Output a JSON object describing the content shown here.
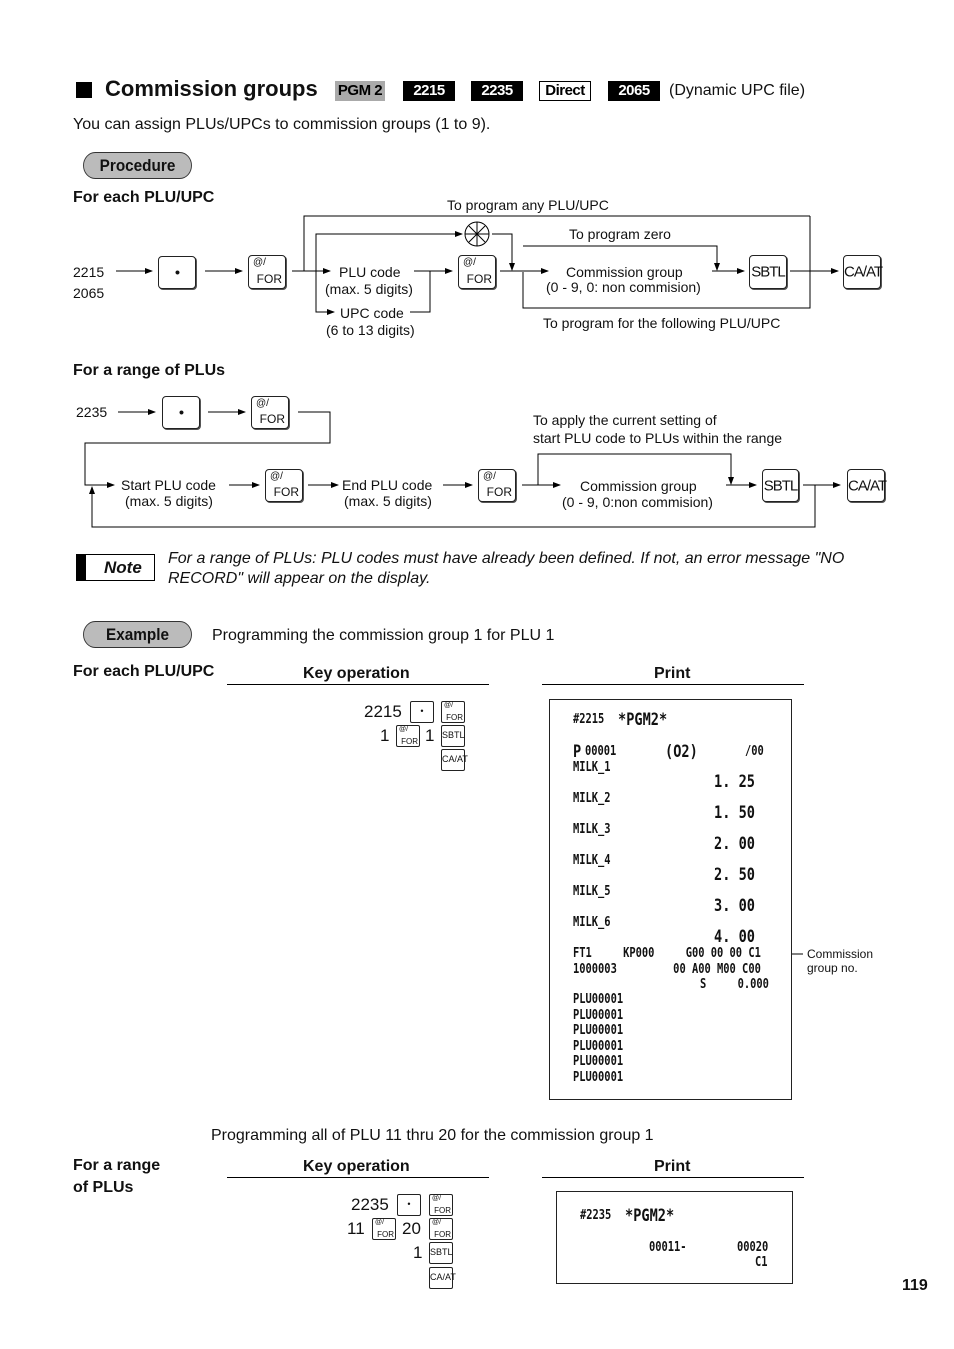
{
  "header": {
    "title": "Commission groups",
    "badges": [
      "PGM 2",
      "2215",
      "2235",
      "Direct",
      "2065"
    ],
    "file_note": "(Dynamic UPC file)"
  },
  "intro": "You can assign PLUs/UPCs to commission groups (1 to 9).",
  "procedure_label": "Procedure",
  "each": {
    "heading": "For each PLU/UPC",
    "code1": "2215",
    "code2": "2065",
    "plu_code": "PLU code",
    "plu_digits": "(max. 5 digits)",
    "upc_code": "UPC code",
    "upc_digits": "(6 to 13 digits)",
    "loop_any": "To program any PLU/UPC",
    "loop_zero": "To program zero",
    "comm_group": "Commission group",
    "comm_range": "(0 - 9, 0: non commision)",
    "loop_next": "To program for the following PLU/UPC"
  },
  "range": {
    "heading": "For a range of PLUs",
    "code": "2235",
    "start": "Start PLU code",
    "start_digits": "(max. 5 digits)",
    "end": "End PLU code",
    "end_digits": "(max. 5 digits)",
    "comm_group": "Commission group",
    "comm_range": "(0 - 9, 0:non commision)",
    "apply1": "To apply the current setting of",
    "apply2": "start PLU code to PLUs within the range"
  },
  "keys": {
    "dot": "•",
    "at": "@/",
    "for": "FOR",
    "sbtl": "SBTL",
    "caat": "CA/AT"
  },
  "note": {
    "label": "Note",
    "text1": "For a range of PLUs: PLU codes must have already been defined.  If not, an error message \"NO",
    "text2": "RECORD\" will appear on the display."
  },
  "example": {
    "label": "Example",
    "desc": "Programming the commission group 1 for PLU 1",
    "each_heading": "For each PLU/UPC",
    "key_op": "Key operation",
    "print": "Print",
    "ops1": [
      "2215",
      "1",
      "1"
    ],
    "receipt1": {
      "title": "#2215",
      "pgm": "*PGM2*",
      "pline": [
        "P",
        "00001",
        "(O2)",
        "/00"
      ],
      "items": [
        {
          "name": "MILK_1",
          "price": "1. 25"
        },
        {
          "name": "MILK_2",
          "price": "1. 50"
        },
        {
          "name": "MILK_3",
          "price": "2. 00"
        },
        {
          "name": "MILK_4",
          "price": "2. 50"
        },
        {
          "name": "MILK_5",
          "price": "3. 00"
        },
        {
          "name": "MILK_6",
          "price": "4. 00"
        }
      ],
      "l1": "FT1     KP000     G00 00 00 C1",
      "l2": "1000003         00 A00 M00 C00",
      "l3": "S     0.000",
      "plus": [
        "PLU00001",
        "PLU00001",
        "PLU00001",
        "PLU00001",
        "PLU00001",
        "PLU00001"
      ]
    },
    "callout1": "Commission",
    "callout2": "group no.",
    "desc2": "Programming all of PLU 11 thru 20 for the commission group 1",
    "range_heading1": "For a range",
    "range_heading2": "of PLUs",
    "ops2": [
      "2235",
      "11",
      "20",
      "1"
    ],
    "receipt2": {
      "title": "#2235",
      "pgm": "*PGM2*",
      "from": "00011-",
      "to": "00020",
      "group": "C1"
    }
  },
  "page_number": "119"
}
